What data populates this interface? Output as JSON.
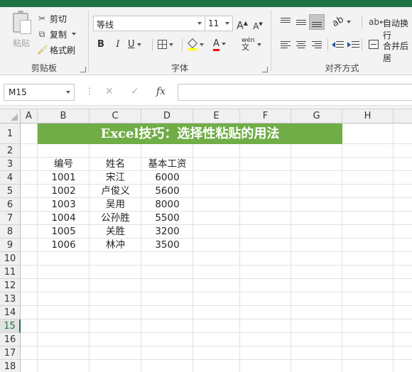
{
  "ribbon": {
    "clipboard": {
      "paste_label": "粘贴",
      "cut_label": "剪切",
      "copy_label": "复制",
      "format_painter_label": "格式刷",
      "group_label": "剪贴板"
    },
    "font": {
      "font_name": "等线",
      "font_size": "11",
      "bold": "B",
      "italic": "I",
      "underline": "U",
      "grow": "A",
      "shrink": "A",
      "font_color": "A",
      "phonetic": "wén",
      "group_label": "字体"
    },
    "alignment": {
      "wrap_text_label": "自动换行",
      "merge_center_label": "合并后居",
      "group_label": "对齐方式"
    }
  },
  "formula_bar": {
    "name_box": "M15",
    "cancel": "✕",
    "enter": "✓",
    "fx": "fx",
    "value": ""
  },
  "grid": {
    "columns": [
      "A",
      "B",
      "C",
      "D",
      "E",
      "F",
      "G",
      "H"
    ],
    "rows": [
      "1",
      "2",
      "3",
      "4",
      "5",
      "6",
      "7",
      "8",
      "9",
      "10",
      "11",
      "12",
      "13",
      "14",
      "15",
      "16",
      "17",
      "18"
    ],
    "active_row": "15",
    "title": "Excel技巧：选择性粘贴的用法",
    "title_fill": "#70ad47",
    "header": [
      "编号",
      "姓名",
      "基本工资"
    ],
    "records": [
      [
        "1001",
        "宋江",
        "6000"
      ],
      [
        "1002",
        "卢俊义",
        "5600"
      ],
      [
        "1003",
        "吴用",
        "8000"
      ],
      [
        "1004",
        "公孙胜",
        "5500"
      ],
      [
        "1005",
        "关胜",
        "3200"
      ],
      [
        "1006",
        "林冲",
        "3500"
      ]
    ]
  },
  "colors": {
    "accent": "#217346"
  }
}
